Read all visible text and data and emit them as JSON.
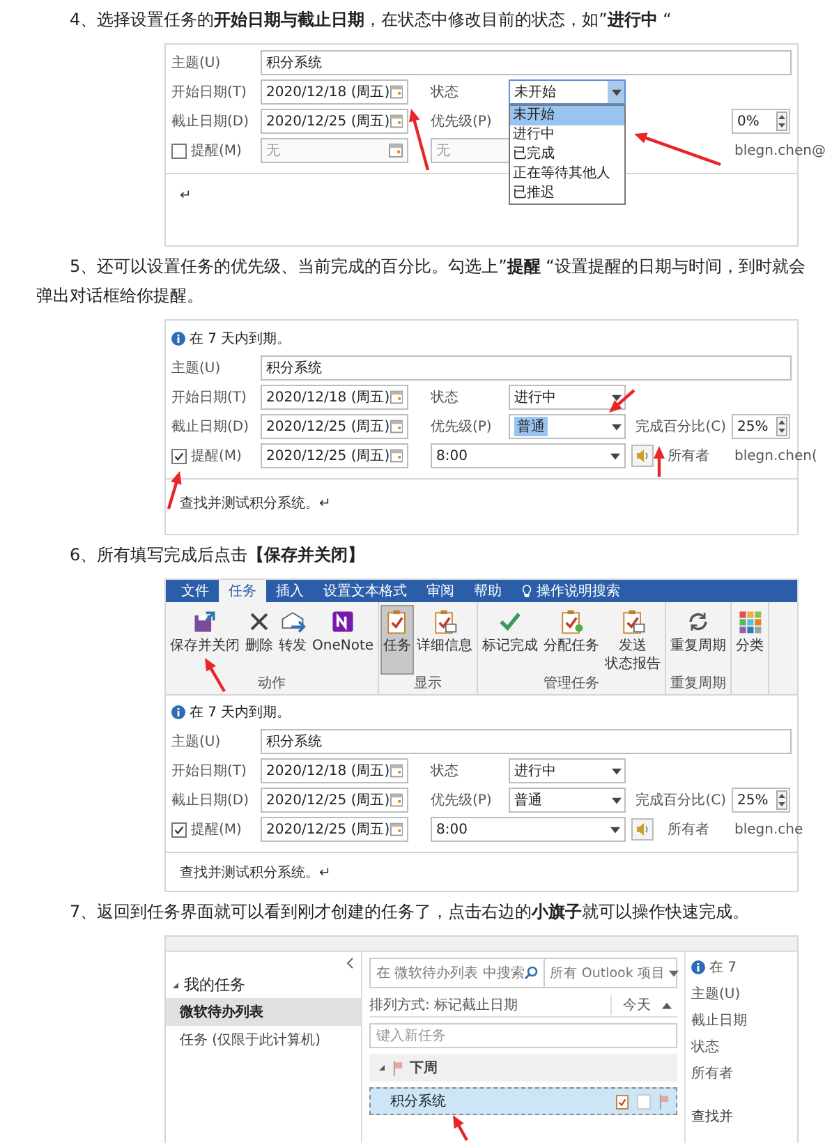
{
  "steps": [
    {
      "kind": "form",
      "text": "4、选择设置任务的**开始日期与截止日期**，在状态中修改目前的状态，如”**进行中** “",
      "form": {
        "subject": {
          "label": "主题(U)",
          "value": "积分系统"
        },
        "start": {
          "label": "开始日期(T)",
          "value": "2020/12/18 (周五)"
        },
        "status": {
          "label": "状态",
          "value": "未开始",
          "open": true,
          "options": [
            {
              "label": "未开始",
              "selected": true
            },
            {
              "label": "进行中",
              "selected": false
            },
            {
              "label": "已完成",
              "selected": false
            },
            {
              "label": "正在等待其他人",
              "selected": false
            },
            {
              "label": "已推迟",
              "selected": false
            }
          ]
        },
        "due": {
          "label": "截止日期(D)",
          "value": "2020/12/25 (周五)"
        },
        "priority": {
          "label": "优先级(P)"
        },
        "percent": {
          "value": "0%"
        },
        "reminder": {
          "label": "提醒(M)",
          "checked": false,
          "date": "无",
          "time": "无"
        },
        "owner": {
          "value": "blegn.chen@"
        },
        "body": "↵"
      }
    },
    {
      "kind": "form",
      "text": "5、还可以设置任务的优先级、当前完成的百分比。勾选上”**提醒** “设置提醒的日期与时间，到时就会弹出对话框给你提醒。",
      "form": {
        "info": "在 7 天内到期。",
        "subject": {
          "label": "主题(U)",
          "value": "积分系统"
        },
        "start": {
          "label": "开始日期(T)",
          "value": "2020/12/18 (周五)"
        },
        "status": {
          "label": "状态",
          "value": "进行中",
          "open": false
        },
        "due": {
          "label": "截止日期(D)",
          "value": "2020/12/25 (周五)"
        },
        "priority": {
          "label": "优先级(P)",
          "value": "普通",
          "highlighted": true
        },
        "percent": {
          "label": "完成百分比(C)",
          "value": "25%"
        },
        "reminder": {
          "label": "提醒(M)",
          "checked": true,
          "date": "2020/12/25 (周五)",
          "time": "8:00"
        },
        "owner": {
          "label": "所有者",
          "value": "blegn.chen("
        },
        "body": "查找并测试积分系统。↵"
      }
    },
    {
      "kind": "ribbon_form",
      "text": "6、所有填写完成后点击**【保存并关闭】**",
      "ribbon": {
        "tabs": [
          {
            "label": "文件",
            "selected": false
          },
          {
            "label": "任务",
            "selected": true
          },
          {
            "label": "插入",
            "selected": false
          },
          {
            "label": "设置文本格式",
            "selected": false
          },
          {
            "label": "审阅",
            "selected": false
          },
          {
            "label": "帮助",
            "selected": false
          },
          {
            "label": "操作说明搜索",
            "selected": false
          }
        ],
        "groups": [
          {
            "label": "动作",
            "buttons": [
              {
                "label": "保存并关闭",
                "selected": false
              },
              {
                "label": "删除",
                "selected": false
              },
              {
                "label": "转发",
                "selected": false
              },
              {
                "label": "OneNote",
                "selected": false
              }
            ]
          },
          {
            "label": "显示",
            "buttons": [
              {
                "label": "任务",
                "selected": true
              },
              {
                "label": "详细信息",
                "selected": false
              }
            ]
          },
          {
            "label": "管理任务",
            "buttons": [
              {
                "label": "标记完成",
                "selected": false
              },
              {
                "label": "分配任务",
                "selected": false
              },
              {
                "label": "发送",
                "label_2": "状态报告",
                "selected": false
              }
            ]
          },
          {
            "label": "重复周期",
            "buttons": [
              {
                "label": "重复周期",
                "selected": false
              }
            ]
          },
          {
            "buttons": [
              {
                "label": "分类",
                "selected": false
              }
            ]
          }
        ]
      },
      "form": {
        "info": "在 7 天内到期。",
        "subject": {
          "label": "主题(U)",
          "value": "积分系统"
        },
        "start": {
          "label": "开始日期(T)",
          "value": "2020/12/18 (周五)"
        },
        "status": {
          "label": "状态",
          "value": "进行中",
          "open": false
        },
        "due": {
          "label": "截止日期(D)",
          "value": "2020/12/25 (周五)"
        },
        "priority": {
          "label": "优先级(P)",
          "value": "普通",
          "highlighted": false
        },
        "percent": {
          "label": "完成百分比(C)",
          "value": "25%"
        },
        "reminder": {
          "label": "提醒(M)",
          "checked": true,
          "date": "2020/12/25 (周五)",
          "time": "8:00"
        },
        "owner": {
          "label": "所有者",
          "value": "blegn.che"
        },
        "body": "查找并测试积分系统。↵"
      }
    },
    {
      "kind": "task_list",
      "text": "7、返回到任务界面就可以看到刚才创建的任务了，点击右边的**小旗子**就可以操作快速完成。",
      "nav": [
        {
          "label": "我的任务",
          "expanded": true,
          "children": [
            {
              "label": "微软待办列表",
              "selected": true
            },
            {
              "label": "任务 (仅限于此计算机)",
              "selected": false
            }
          ]
        }
      ],
      "list": {
        "search_placeholder": "在 微软待办列表 中搜索",
        "scope": "所有 Outlook 项目",
        "sort": "排列方式: 标记截止日期",
        "sort_value": "今天",
        "new_task_placeholder": "键入新任务",
        "groups": [
          {
            "label": "下周",
            "expanded": true,
            "tasks": [
              {
                "title": "积分系统",
                "selected": true
              }
            ]
          }
        ]
      },
      "reading": {
        "info": "在 7",
        "labels": [
          "主题(U)",
          "截止日期",
          "状态",
          "所有者"
        ],
        "body": "查找并"
      }
    }
  ]
}
